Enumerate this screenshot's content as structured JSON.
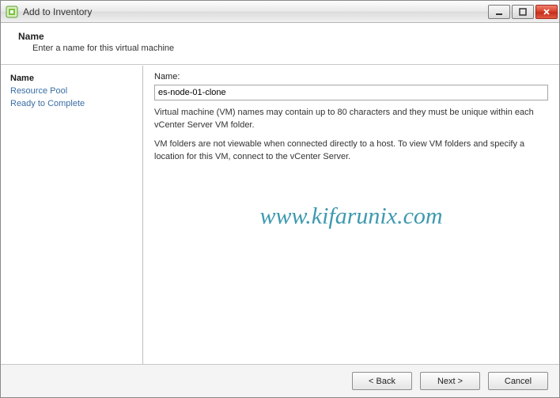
{
  "window": {
    "title": "Add to Inventory"
  },
  "header": {
    "title": "Name",
    "subtitle": "Enter a name for this virtual machine"
  },
  "sidebar": {
    "items": [
      {
        "label": "Name",
        "active": true
      },
      {
        "label": "Resource Pool",
        "active": false
      },
      {
        "label": "Ready to Complete",
        "active": false
      }
    ]
  },
  "content": {
    "field_label": "Name:",
    "name_value": "es-node-01-clone",
    "hint1": "Virtual machine (VM) names may contain up to 80 characters and they must be unique within each vCenter Server VM folder.",
    "hint2": "VM folders are not viewable when connected directly to a host. To view VM folders and specify a location for this VM, connect to the vCenter Server."
  },
  "watermark": "www.kifarunix.com",
  "footer": {
    "back": "< Back",
    "next": "Next >",
    "cancel": "Cancel"
  }
}
